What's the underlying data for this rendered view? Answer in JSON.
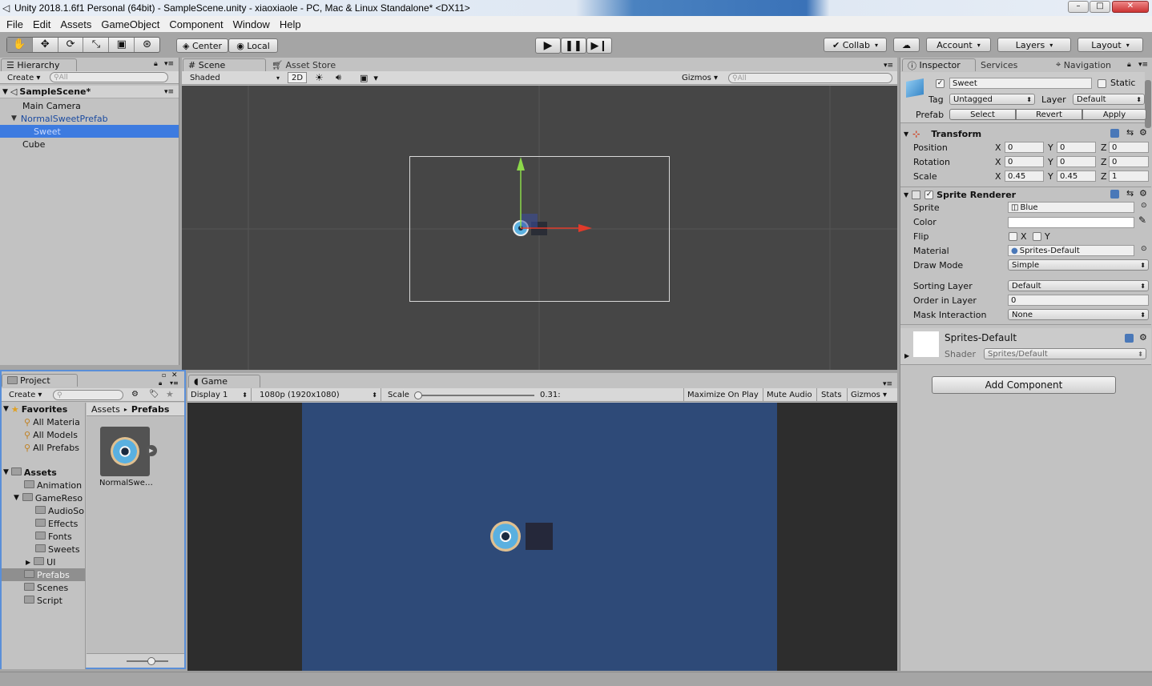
{
  "window": {
    "title": "Unity 2018.1.6f1 Personal (64bit) - SampleScene.unity - xiaoxiaole - PC, Mac & Linux Standalone* <DX11>",
    "min": "–",
    "max": "□",
    "close": "✕"
  },
  "menu": [
    "File",
    "Edit",
    "Assets",
    "GameObject",
    "Component",
    "Window",
    "Help"
  ],
  "toolbar": {
    "center": "Center",
    "local": "Local",
    "collab": "Collab",
    "account": "Account",
    "layers": "Layers",
    "layout": "Layout"
  },
  "hierarchy": {
    "tab": "Hierarchy",
    "create": "Create",
    "search": "All",
    "scene": "SampleScene*",
    "items": [
      "Main Camera",
      "NormalSweetPrefab",
      "Sweet",
      "Cube"
    ]
  },
  "scene": {
    "tab": "Scene",
    "tab2": "Asset Store",
    "shaded": "Shaded",
    "mode2d": "2D",
    "gizmos": "Gizmos",
    "search": "All"
  },
  "game": {
    "tab": "Game",
    "display": "Display 1",
    "resolution": "1080p (1920x1080)",
    "scale_label": "Scale",
    "scale_value": "0.31:",
    "maximize": "Maximize On Play",
    "mute": "Mute Audio",
    "stats": "Stats",
    "gizmos": "Gizmos",
    "bg": "#2e4a78"
  },
  "project": {
    "tab": "Project",
    "create": "Create",
    "favorites": "Favorites",
    "fav_items": [
      "All Materia",
      "All Models",
      "All Prefabs"
    ],
    "assets": "Assets",
    "tree": [
      "Animation",
      "GameReso",
      "AudioSo",
      "Effects",
      "Fonts",
      "Sweets",
      "UI",
      "Prefabs",
      "Scenes",
      "Script"
    ],
    "breadcrumb": [
      "Assets",
      "Prefabs"
    ],
    "asset_label": "NormalSwe…"
  },
  "inspector": {
    "tab": "Inspector",
    "tab2": "Services",
    "tab3": "Navigation",
    "name": "Sweet",
    "static": "Static",
    "tag_label": "Tag",
    "tag": "Untagged",
    "layer_label": "Layer",
    "layer": "Default",
    "prefab_label": "Prefab",
    "select": "Select",
    "revert": "Revert",
    "apply": "Apply",
    "transform": {
      "title": "Transform",
      "rows": [
        {
          "label": "Position",
          "x": "0",
          "y": "0",
          "z": "0"
        },
        {
          "label": "Rotation",
          "x": "0",
          "y": "0",
          "z": "0"
        },
        {
          "label": "Scale",
          "x": "0.45",
          "y": "0.45",
          "z": "1"
        }
      ]
    },
    "xyz": [
      "X",
      "Y",
      "Z"
    ],
    "sprite_renderer": {
      "title": "Sprite Renderer",
      "sprite_label": "Sprite",
      "sprite": "Blue",
      "color_label": "Color",
      "flip_label": "Flip",
      "flip_x": "X",
      "flip_y": "Y",
      "material_label": "Material",
      "material": "Sprites-Default",
      "draw_mode_label": "Draw Mode",
      "draw_mode": "Simple",
      "sorting_layer_label": "Sorting Layer",
      "sorting_layer": "Default",
      "order_label": "Order in Layer",
      "order": "0",
      "mask_label": "Mask Interaction",
      "mask": "None"
    },
    "material": {
      "name": "Sprites-Default",
      "shader_label": "Shader",
      "shader": "Sprites/Default"
    },
    "add_component": "Add Component"
  }
}
